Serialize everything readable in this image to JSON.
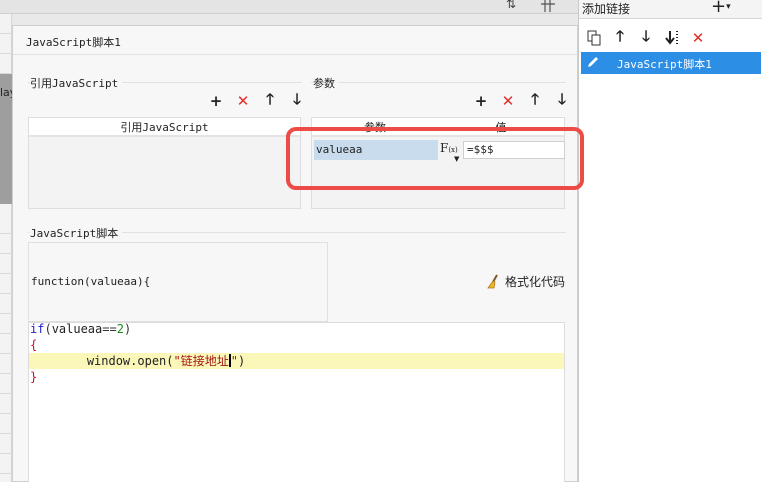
{
  "background": {
    "strip_text": "lay"
  },
  "right_panel": {
    "title": "添加链接",
    "add_symbol": "+",
    "add_caret": "▾",
    "toolbar": {
      "copy_icon": "copy-icon",
      "up_icon": "arrow-up-icon",
      "down_icon": "arrow-down-icon",
      "move_bottom_icon": "move-bottom-icon",
      "delete_icon": "delete-icon"
    },
    "items": [
      {
        "label": "JavaScript脚本1",
        "selected": true
      }
    ],
    "selected_color": "#2d8ee6"
  },
  "dialog": {
    "title": "JavaScript脚本1",
    "imports_section": {
      "label": "引用JavaScript",
      "column_header": "引用JavaScript"
    },
    "params_section": {
      "label": "参数",
      "columns": [
        "参数",
        "值"
      ],
      "rows": [
        {
          "name": "valueaa",
          "fx": "F",
          "fx_sub": "(x)",
          "value": "=$$$"
        }
      ]
    },
    "script_section": {
      "label": "JavaScript脚本",
      "signature": "function(valueaa){",
      "format_button": "格式化代码",
      "code_lines": [
        {
          "kw": "if",
          "open": "(",
          "var": "valueaa",
          "op": "==",
          "num": "2",
          "close": ")"
        },
        {
          "brace": "{"
        },
        {
          "indent": "    ",
          "call": "window.open(",
          "str": "\"链接地址",
          "str_end": "\"",
          "end": ")"
        },
        {
          "brace": "}"
        }
      ]
    },
    "highlight_color": "#ec4b46"
  }
}
